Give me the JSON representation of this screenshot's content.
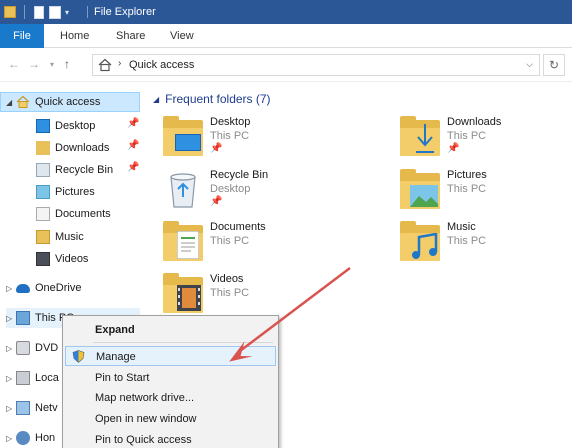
{
  "window": {
    "title": "File Explorer"
  },
  "ribbon": {
    "tabs": [
      "File",
      "Home",
      "Share",
      "View"
    ]
  },
  "address": {
    "breadcrumb": "Quick access"
  },
  "navpane": {
    "quick_access": "Quick access",
    "items": [
      "Desktop",
      "Downloads",
      "Recycle Bin",
      "Pictures",
      "Documents",
      "Music",
      "Videos"
    ],
    "onedrive": "OneDrive",
    "this_pc": "This PC",
    "dvd": "DVD",
    "local": "Loca",
    "network": "Netv",
    "homegroup": "Hon"
  },
  "content": {
    "section_title": "Frequent folders (7)",
    "folders": [
      {
        "name": "Desktop",
        "location": "This PC",
        "icon": "desktop-folder-icon"
      },
      {
        "name": "Downloads",
        "location": "This PC",
        "icon": "downloads-folder-icon"
      },
      {
        "name": "Recycle Bin",
        "location": "Desktop",
        "icon": "recycle-bin-icon"
      },
      {
        "name": "Pictures",
        "location": "This PC",
        "icon": "pictures-folder-icon"
      },
      {
        "name": "Documents",
        "location": "This PC",
        "icon": "documents-folder-icon"
      },
      {
        "name": "Music",
        "location": "This PC",
        "icon": "music-folder-icon"
      },
      {
        "name": "Videos",
        "location": "This PC",
        "icon": "videos-folder-icon"
      }
    ]
  },
  "context_menu": {
    "items": [
      "Expand",
      "Manage",
      "Pin to Start",
      "Map network drive...",
      "Open in new window",
      "Pin to Quick access"
    ],
    "highlighted": "Manage"
  },
  "colors": {
    "titlebar": "#2b5797",
    "file_tab": "#1979ca",
    "section_title": "#1e3d8f",
    "arrow": "#d9534f"
  }
}
